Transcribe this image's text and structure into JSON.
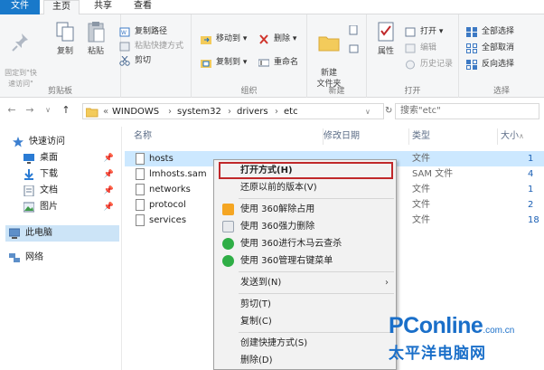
{
  "tabs": {
    "file": "文件",
    "home": "主页",
    "share": "共享",
    "view": "查看"
  },
  "ribbon": {
    "clipboard": {
      "pin": "固定到\"快\n速访问\"",
      "copy": "复制",
      "paste": "粘贴",
      "copy_path": "复制路径",
      "paste_shortcut": "粘贴快捷方式",
      "cut": "剪切",
      "label": "剪贴板"
    },
    "organize": {
      "move_to": "移动到 ▾",
      "copy_to": "复制到 ▾",
      "delete": "删除 ▾",
      "rename": "重命名",
      "label": "组织"
    },
    "new": {
      "new_folder": "新建\n文件夹",
      "label": "新建"
    },
    "open": {
      "properties": "属性",
      "open": "打开 ▾",
      "edit": "编辑",
      "history": "历史记录",
      "label": "打开"
    },
    "select": {
      "select_all": "全部选择",
      "select_none": "全部取消",
      "invert": "反向选择",
      "label": "选择"
    }
  },
  "address": {
    "prefix": "«",
    "crumbs": [
      "WINDOWS",
      "system32",
      "drivers",
      "etc"
    ],
    "separator": "›",
    "search_placeholder": "搜索\"etc\""
  },
  "nav": {
    "quick_access": "快速访问",
    "items": [
      {
        "label": "桌面",
        "icon": "desktop-icon"
      },
      {
        "label": "下载",
        "icon": "download-icon"
      },
      {
        "label": "文档",
        "icon": "document-icon"
      },
      {
        "label": "图片",
        "icon": "picture-icon"
      }
    ],
    "this_pc": "此电脑",
    "network": "网络"
  },
  "columns": {
    "name": "名称",
    "modified": "修改日期",
    "type": "类型",
    "size": "大小"
  },
  "files": [
    {
      "name": "hosts",
      "type": "文件",
      "size": "1"
    },
    {
      "name": "lmhosts.sam",
      "type": "SAM 文件",
      "size": "4"
    },
    {
      "name": "networks",
      "type": "文件",
      "size": "1"
    },
    {
      "name": "protocol",
      "type": "文件",
      "size": "2"
    },
    {
      "name": "services",
      "type": "文件",
      "size": "18"
    }
  ],
  "context_menu": {
    "open_with": "打开方式(H)",
    "restore": "还原以前的版本(V)",
    "unlock_360": "使用 360解除占用",
    "force_delete_360": "使用 360强力删除",
    "cloud_scan_360": "使用 360进行木马云查杀",
    "manage_menu_360": "使用 360管理右键菜单",
    "send_to": "发送到(N)",
    "cut": "剪切(T)",
    "copy": "复制(C)",
    "create_shortcut": "创建快捷方式(S)",
    "delete": "删除(D)"
  },
  "watermark": {
    "brand": "PConline",
    "domain": ".com.cn",
    "cn": "太平洋电脑网"
  },
  "colors": {
    "accent": "#1979ca",
    "highlight_border": "#c0282a",
    "brand_blue": "#1a6fc9"
  }
}
